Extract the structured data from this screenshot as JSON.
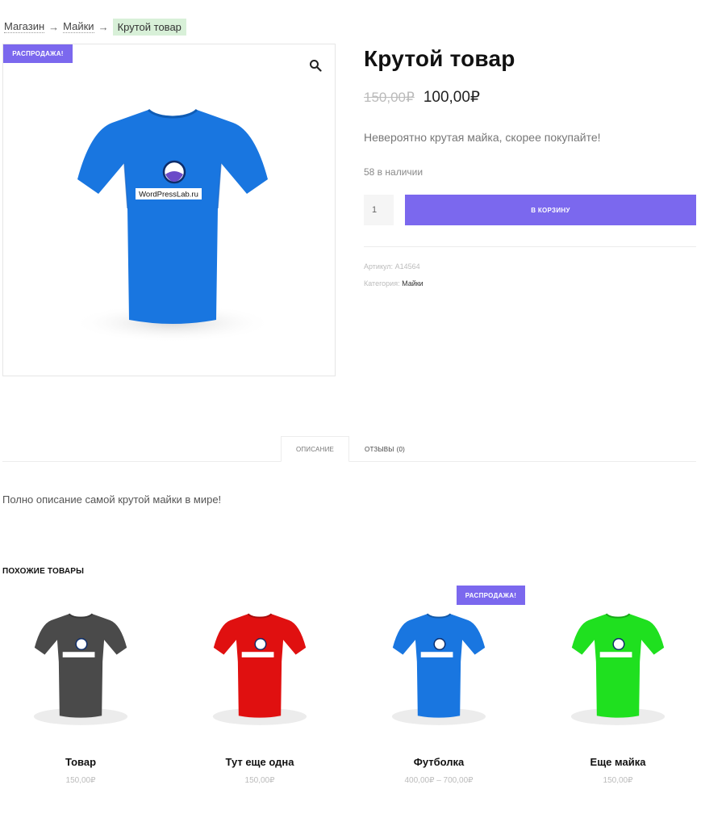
{
  "breadcrumb": {
    "shop": "Магазин",
    "sep": "→",
    "category": "Майки",
    "current": "Крутой товар"
  },
  "product": {
    "sale_badge": "Распродажа!",
    "title": "Крутой товар",
    "old_price": "150,00₽",
    "new_price": "100,00₽",
    "short_description": "Невероятно крутая майка, скорее покупайте!",
    "stock": "58 в наличии",
    "quantity": "1",
    "add_to_cart": "В корзину",
    "sku_label": "Артикул:",
    "sku": "A14564",
    "category_label": "Категория:",
    "category": "Майки",
    "image": {
      "color": "#1976e0",
      "logo_text": "WordPressLab.ru"
    }
  },
  "tabs": {
    "description": "Описание",
    "reviews": "Отзывы",
    "reviews_count": "(0)"
  },
  "description_text": "Полно описание самой крутой майки в мире!",
  "related": {
    "title": "Похожие товары",
    "items": [
      {
        "name": "Товар",
        "price": "150,00₽",
        "color": "#4a4a4a",
        "sale": false
      },
      {
        "name": "Тут еще одна",
        "price": "150,00₽",
        "color": "#e01010",
        "sale": false
      },
      {
        "name": "Футболка",
        "price": "400,00₽ – 700,00₽",
        "color": "#1976e0",
        "sale": true,
        "sale_label": "Распродажа!"
      },
      {
        "name": "Еще майка",
        "price": "150,00₽",
        "color": "#1fe01f",
        "sale": false
      }
    ]
  }
}
